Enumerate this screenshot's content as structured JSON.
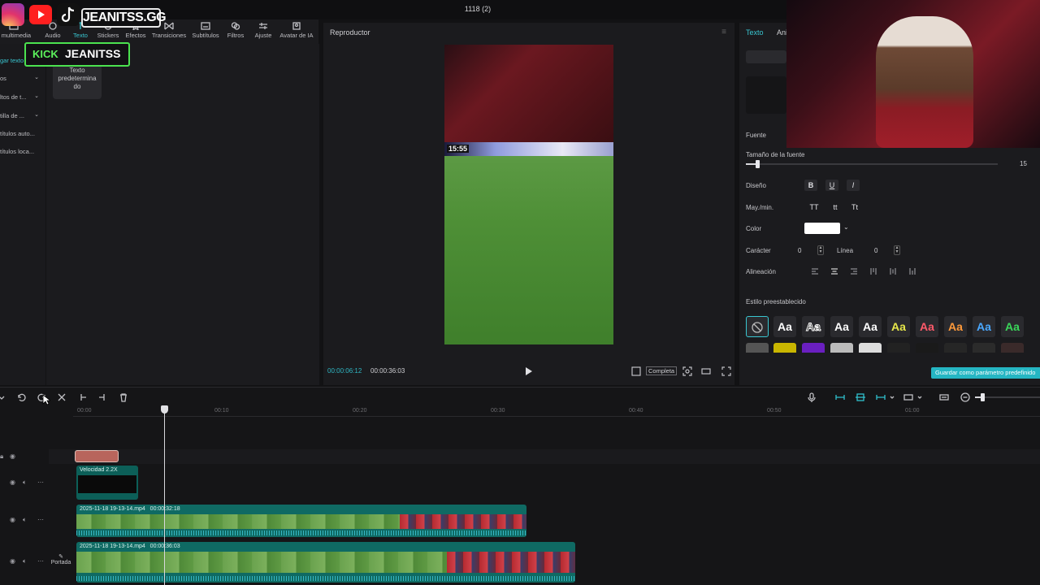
{
  "window": {
    "project_title": "1118 (2)"
  },
  "toolbar": {
    "tools": [
      {
        "label": "Medios multimedia",
        "display": "s multimedia"
      },
      {
        "label": "Audio"
      },
      {
        "label": "Texto"
      },
      {
        "label": "Stickers"
      },
      {
        "label": "Efectos"
      },
      {
        "label": "Transiciones"
      },
      {
        "label": "Subtítulos"
      },
      {
        "label": "Filtros"
      },
      {
        "label": "Ajuste"
      },
      {
        "label": "Avatar de IA"
      }
    ]
  },
  "left_panel": {
    "categories": [
      "gar texto",
      "os",
      "ltos de t...",
      "tilla de ...",
      "títulos auto...",
      "títulos loca..."
    ],
    "preset_card": "Texto predeterminado",
    "preset_card_visible": "Texto\npredetermina\ndo"
  },
  "player": {
    "title": "Reproductor",
    "video_clock": "15:55",
    "current_time": "00:00:06:12",
    "total_time": "00:00:36:03",
    "ratio_button": "Completa"
  },
  "right_panel": {
    "tabs": [
      "Texto",
      "Ani"
    ],
    "font_label": "Fuente",
    "font_size_label": "Tamaño de la fuente",
    "font_size_value": "15",
    "font_size_fraction": 0.04,
    "design_label": "Diseño",
    "style_buttons": [
      "B",
      "U",
      "I"
    ],
    "case_label": "May./min.",
    "case_buttons": [
      "TT",
      "tt",
      "Tt"
    ],
    "color_label": "Color",
    "color_value": "#ffffff",
    "char_label": "Carácter",
    "char_value": "0",
    "line_label": "Línea",
    "line_value": "0",
    "align_label": "Alineación",
    "preset_style_label": "Estilo preestablecido",
    "preset_tiles": [
      {
        "text": "",
        "color": "#888888"
      },
      {
        "text": "Aa",
        "color": "#ffffff"
      },
      {
        "text": "Aa",
        "color": "#ffffff"
      },
      {
        "text": "Aa",
        "color": "#ffffff"
      },
      {
        "text": "Aa",
        "color": "#ffffff"
      },
      {
        "text": "Aa",
        "color": "#e8e84a"
      },
      {
        "text": "Aa",
        "color": "#ff5a6a"
      },
      {
        "text": "Aa",
        "color": "#ff9a3a"
      },
      {
        "text": "Aa",
        "color": "#4aa8ff"
      },
      {
        "text": "Aa",
        "color": "#3ad65a"
      }
    ],
    "save_preset_button": "Guardar como parámetro predefinido"
  },
  "overlay": {
    "social_handle": "JEANITSS.GG",
    "kick_label": "KICK",
    "kick_handle": "JEANITSS"
  },
  "timeline": {
    "ruler": [
      "00:00",
      "00:10",
      "00:20",
      "00:30",
      "00:40",
      "00:50",
      "01:00"
    ],
    "fx_clip_label": "Velocidad 2.2X",
    "video_clips": [
      {
        "name": "2025-11-18 19-13-14.mp4",
        "duration": "00:00:32:18"
      },
      {
        "name": "2025-11-18 19-13-14.mp4",
        "duration": "00:00:36:03"
      }
    ],
    "cover_label": "Portada"
  },
  "colors": {
    "accent": "#39c6d1",
    "text_clip": "#b8655c",
    "video_clip": "#0f6a63"
  }
}
